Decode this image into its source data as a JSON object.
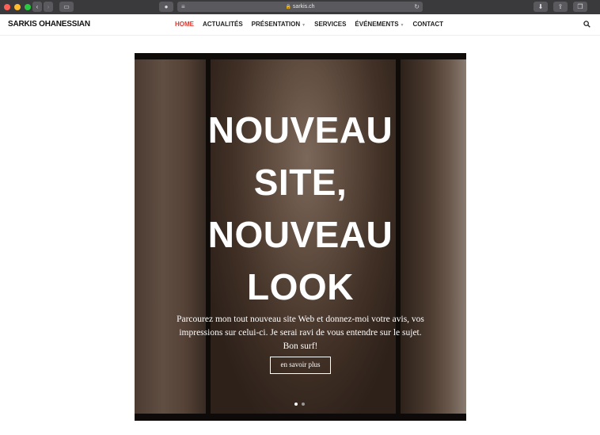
{
  "browser": {
    "url": "sarkis.ch"
  },
  "site": {
    "logo": "SARKIS OHANESSIAN",
    "nav": [
      {
        "label": "HOME",
        "active": true
      },
      {
        "label": "ACTUALITÉS"
      },
      {
        "label": "PRÉSENTATION",
        "dropdown": true
      },
      {
        "label": "SERVICES"
      },
      {
        "label": "ÉVÉNEMENTS",
        "dropdown": true
      },
      {
        "label": "CONTACT"
      }
    ],
    "accent_color": "#e0352b"
  },
  "hero": {
    "title_lines": [
      "NOUVEAU",
      "SITE,",
      "NOUVEAU",
      "LOOK"
    ],
    "text": "Parcourez mon tout nouveau site Web et donnez-moi votre avis, vos impressions sur celui-ci. Je serai ravi de vous entendre sur le sujet. Bon surf!",
    "cta_label": "en savoir plus",
    "slides": 2,
    "active_slide": 1
  },
  "icons": {
    "search": "search-icon"
  }
}
